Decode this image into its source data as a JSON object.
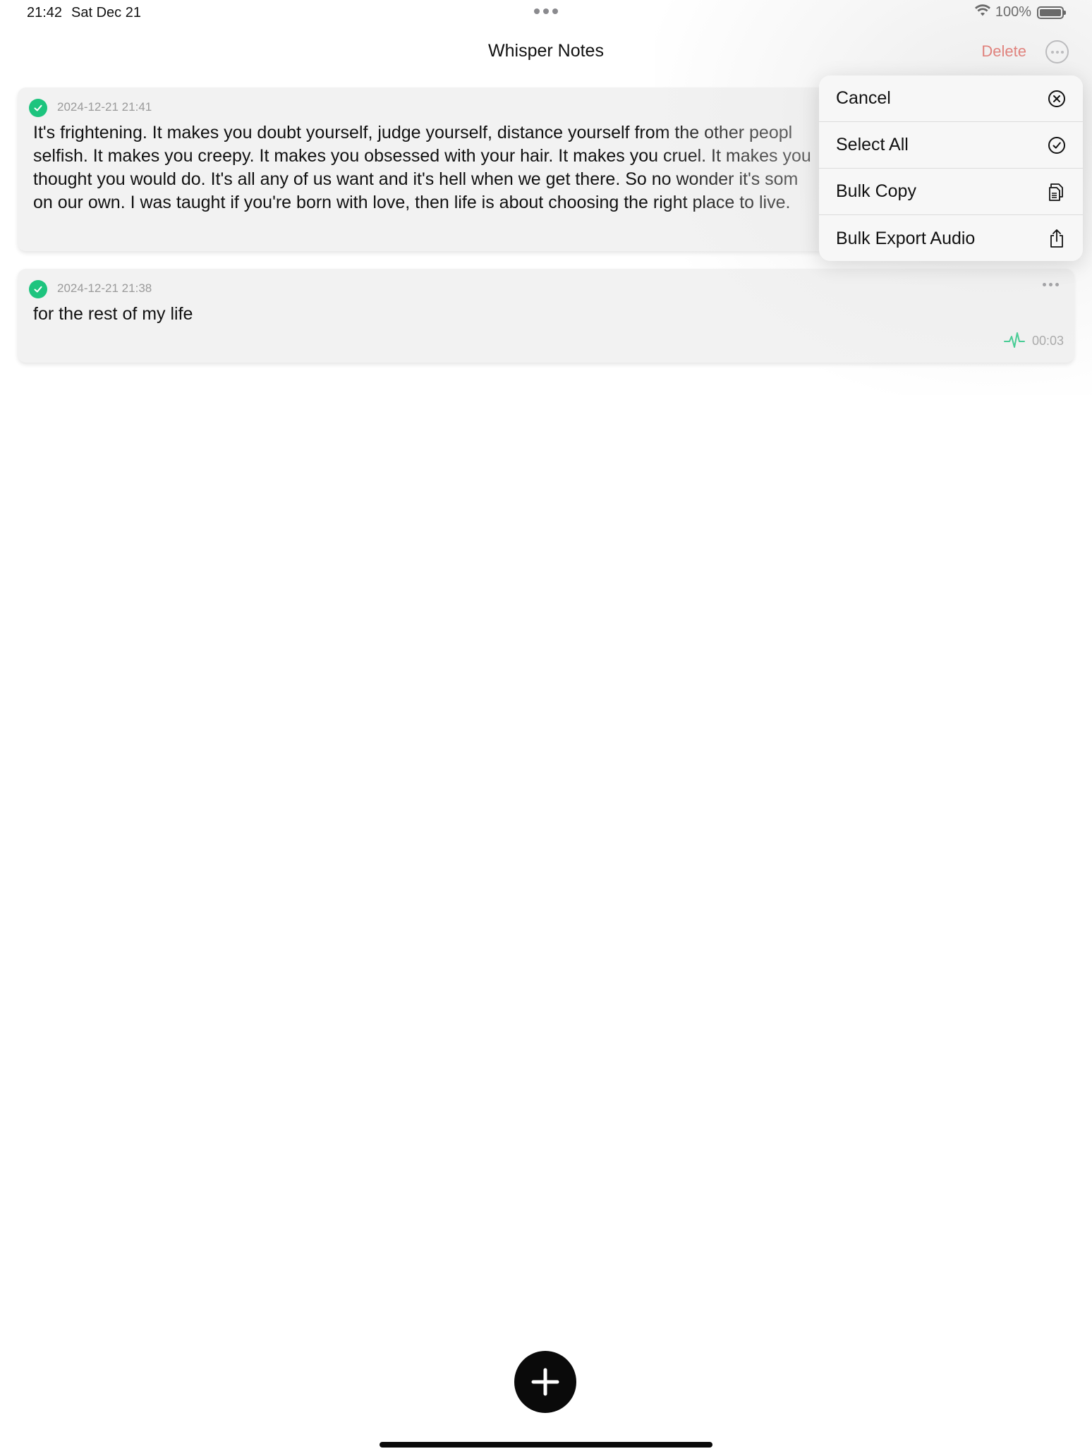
{
  "status_bar": {
    "time": "21:42",
    "date": "Sat Dec 21",
    "battery_percent": "100%",
    "battery_level": 1.0
  },
  "nav": {
    "title": "Whisper Notes",
    "delete_label": "Delete"
  },
  "notes": [
    {
      "timestamp": "2024-12-21 21:41",
      "selected": true,
      "text": "It's frightening. It makes you doubt yourself, judge yourself, distance yourself from the other peopl\nselfish. It makes you creepy. It makes you obsessed with your hair. It makes you cruel. It makes you\nthought you would do. It's all any of us want and it's hell when we get there. So no wonder it's som\non our own. I was taught if you're born with love, then life is about choosing the right place to live."
    },
    {
      "timestamp": "2024-12-21 21:38",
      "selected": true,
      "text": "for the rest of my life",
      "duration": "00:03"
    }
  ],
  "menu": {
    "items": [
      {
        "label": "Cancel",
        "icon": "xmark-circle-icon"
      },
      {
        "label": "Select All",
        "icon": "checkmark-circle-icon"
      },
      {
        "label": "Bulk Copy",
        "icon": "copy-documents-icon"
      },
      {
        "label": "Bulk Export Audio",
        "icon": "share-icon"
      }
    ]
  },
  "colors": {
    "accent_green": "#1dc47e",
    "destructive_red": "#e02e24",
    "card_bg": "#f2f2f2"
  }
}
